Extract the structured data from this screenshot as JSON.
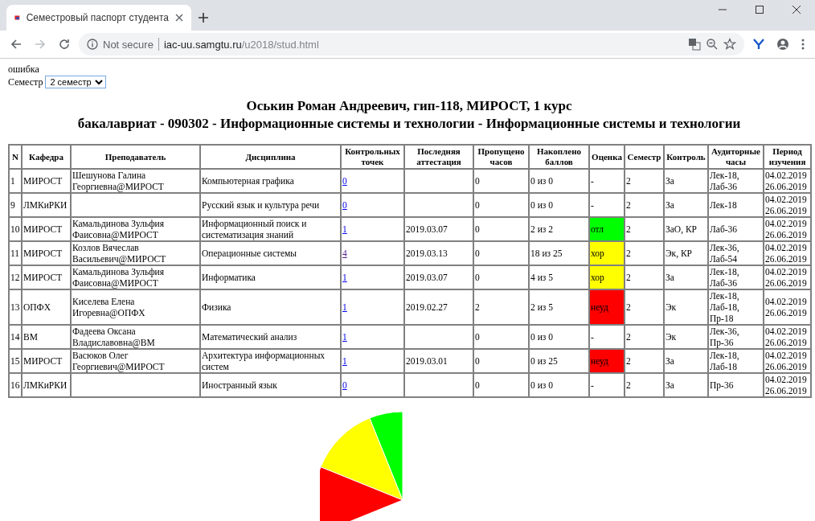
{
  "browser": {
    "tab_title": "Семестровый паспорт студента",
    "security": "Not secure",
    "url_host": "iac-uu.samgtu.ru",
    "url_path": "/u2018/stud.html"
  },
  "page": {
    "error": "ошибка",
    "semester_label": "Семестр",
    "semester_value": "2 семестр",
    "heading": [
      "Оськин Роман Андреевич, гип-118, МИРОСТ, 1 курс",
      "бакалавриат - 090302 - Информационные системы и технологии - Информационные системы и технологии"
    ]
  },
  "table": {
    "columns": [
      "N",
      "Кафедра",
      "Преподаватель",
      "Дисциплина",
      "Контрольных точек",
      "Последняя аттестация",
      "Пропущено часов",
      "Накоплено баллов",
      "Оценка",
      "Семестр",
      "Контроль",
      "Аудиторные часы",
      "Период изучения"
    ],
    "rows": [
      {
        "n": "1",
        "department": "МИРОСТ",
        "teacher": "Шешунова Галина Георгиевна@МИРОСТ",
        "discipline": "Компьютерная графика",
        "points": {
          "text": "0",
          "visited": false
        },
        "last": "",
        "missed": "0",
        "accumulated": "0 из 0",
        "grade": {
          "text": "-"
        },
        "semester": "2",
        "control": "За",
        "hours": "Лек-18, Лаб-36",
        "period": "04.02.2019 26.06.2019"
      },
      {
        "n": "9",
        "department": "ЛМКиРКИ",
        "teacher": "",
        "discipline": "Русский язык и культура речи",
        "points": {
          "text": "0",
          "visited": false
        },
        "last": "",
        "missed": "0",
        "accumulated": "0 из 0",
        "grade": {
          "text": "-"
        },
        "semester": "2",
        "control": "За",
        "hours": "Лек-18",
        "period": "04.02.2019 26.06.2019"
      },
      {
        "n": "10",
        "department": "МИРОСТ",
        "teacher": "Камальдинова Зульфия Фаисовна@МИРОСТ",
        "discipline": "Информационный поиск и систематизация знаний",
        "points": {
          "text": "1",
          "visited": false
        },
        "last": "2019.03.07",
        "missed": "0",
        "accumulated": "2 из 2",
        "grade": {
          "text": "отл",
          "color": "#00ff00"
        },
        "semester": "2",
        "control": "ЗаО, КР",
        "hours": "Лаб-36",
        "period": "04.02.2019 26.06.2019"
      },
      {
        "n": "11",
        "department": "МИРОСТ",
        "teacher": "Козлов Вячеслав Васильевич@МИРОСТ",
        "discipline": "Операционные системы",
        "points": {
          "text": "4",
          "visited": true
        },
        "last": "2019.03.13",
        "missed": "0",
        "accumulated": "18 из 25",
        "grade": {
          "text": "хор",
          "color": "#ffff00"
        },
        "semester": "2",
        "control": "Эк, КР",
        "hours": "Лек-36, Лаб-54",
        "period": "04.02.2019 26.06.2019"
      },
      {
        "n": "12",
        "department": "МИРОСТ",
        "teacher": "Камальдинова Зульфия Фаисовна@МИРОСТ",
        "discipline": "Информатика",
        "points": {
          "text": "1",
          "visited": false
        },
        "last": "2019.03.07",
        "missed": "0",
        "accumulated": "4 из 5",
        "grade": {
          "text": "хор",
          "color": "#ffff00"
        },
        "semester": "2",
        "control": "За",
        "hours": "Лек-18, Лаб-36",
        "period": "04.02.2019 26.06.2019"
      },
      {
        "n": "13",
        "department": "ОПФХ",
        "teacher": "Киселева Елена Игоревна@ОПФХ",
        "discipline": "Физика",
        "points": {
          "text": "1",
          "visited": false
        },
        "last": "2019.02.27",
        "missed": "2",
        "accumulated": "2 из 5",
        "grade": {
          "text": "неуд",
          "color": "#ff0000"
        },
        "semester": "2",
        "control": "Эк",
        "hours": "Лек-18, Лаб-18, Пр-18",
        "period": "04.02.2019 26.06.2019"
      },
      {
        "n": "14",
        "department": "ВМ",
        "teacher": "Фадеева Оксана Владиславовна@ВМ",
        "discipline": "Математический анализ",
        "points": {
          "text": "1",
          "visited": false
        },
        "last": "",
        "missed": "0",
        "accumulated": "0 из 0",
        "grade": {
          "text": "-"
        },
        "semester": "2",
        "control": "Эк",
        "hours": "Лек-36, Пр-36",
        "period": "04.02.2019 26.06.2019"
      },
      {
        "n": "15",
        "department": "МИРОСТ",
        "teacher": "Васюков Олег Георгиевич@МИРОСТ",
        "discipline": "Архитектура информационных систем",
        "points": {
          "text": "1",
          "visited": false
        },
        "last": "2019.03.01",
        "missed": "0",
        "accumulated": "0 из 25",
        "grade": {
          "text": "неуд",
          "color": "#ff0000"
        },
        "semester": "2",
        "control": "За",
        "hours": "Лек-18, Лаб-18",
        "period": "04.02.2019 26.06.2019"
      },
      {
        "n": "16",
        "department": "ЛМКиРКИ",
        "teacher": "",
        "discipline": "Иностранный язык",
        "points": {
          "text": "0",
          "visited": false
        },
        "last": "",
        "missed": "0",
        "accumulated": "0 из 0",
        "grade": {
          "text": "-"
        },
        "semester": "2",
        "control": "За",
        "hours": "Пр-36",
        "period": "04.02.2019 26.06.2019"
      }
    ]
  }
}
